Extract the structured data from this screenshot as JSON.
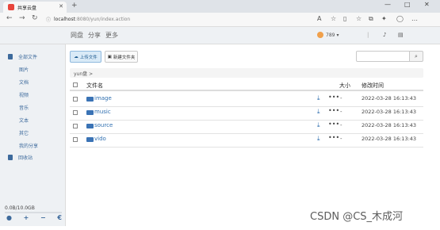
{
  "browser": {
    "tab_title": "共享云盘",
    "url_host": "localhost",
    "url_path": ":8080/yun/index.action",
    "window_controls": [
      "—",
      "□",
      "✕"
    ]
  },
  "header": {
    "nav": [
      "网盘",
      "分享",
      "更多"
    ],
    "username": "789"
  },
  "sidebar": {
    "items": [
      {
        "label": "全部文件",
        "icon": "file-icon",
        "level": 0
      },
      {
        "label": "图片",
        "level": 1
      },
      {
        "label": "文档",
        "level": 1
      },
      {
        "label": "视频",
        "level": 1
      },
      {
        "label": "音乐",
        "level": 1
      },
      {
        "label": "文本",
        "level": 1
      },
      {
        "label": "其它",
        "level": 1
      },
      {
        "label": "我的分享",
        "level": 1
      },
      {
        "label": "回收站",
        "icon": "trash-icon",
        "level": 0
      }
    ],
    "quota_text": "0.0B/10.0GB",
    "quota_fraction": 0.0,
    "bottom_buttons": [
      "●",
      "+",
      "−",
      "€"
    ]
  },
  "toolbar": {
    "upload_label": "上传文件",
    "newfolder_label": "新建文件夹",
    "search_placeholder": ""
  },
  "breadcrumb": "yun盘 >",
  "table": {
    "headers": {
      "name": "文件名",
      "size": "大小",
      "time": "修改时间"
    },
    "rows": [
      {
        "name": "image",
        "size": "-",
        "time": "2022-03-28 16:13:43"
      },
      {
        "name": "music",
        "size": "-",
        "time": "2022-03-28 16:13:43"
      },
      {
        "name": "source",
        "size": "-",
        "time": "2022-03-28 16:13:43"
      },
      {
        "name": "vido",
        "size": "-",
        "time": "2022-03-28 16:13:43"
      }
    ]
  },
  "watermark": "CSDN @CS_木成河"
}
